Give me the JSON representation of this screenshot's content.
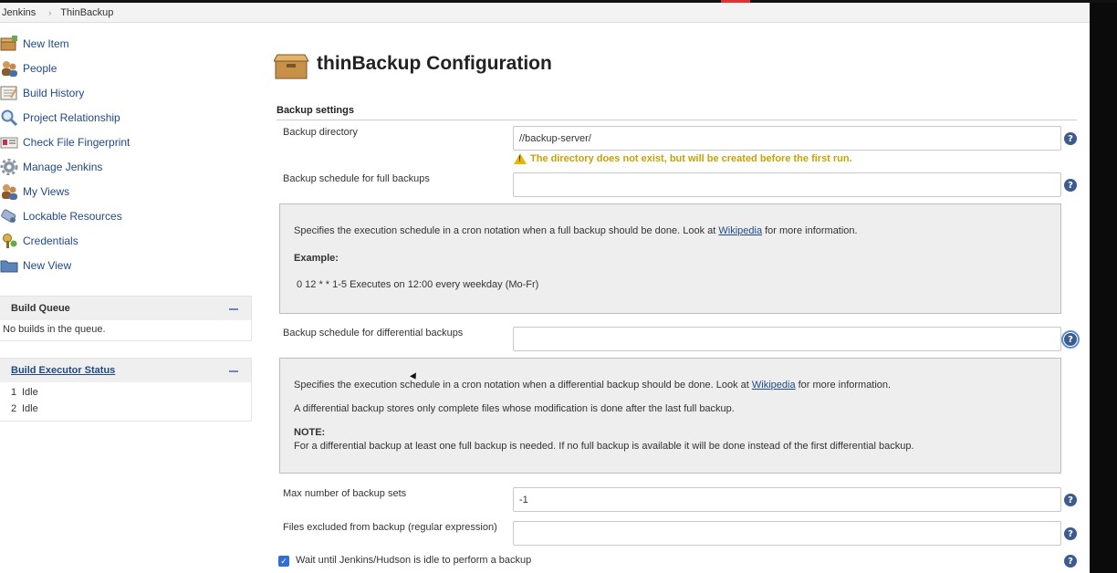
{
  "breadcrumb": {
    "root": "Jenkins",
    "separator": "›",
    "current": "ThinBackup"
  },
  "sidebar": {
    "tasks": [
      {
        "label": "New Item",
        "icon": "new-item-icon"
      },
      {
        "label": "People",
        "icon": "people-icon"
      },
      {
        "label": "Build History",
        "icon": "notepad-icon"
      },
      {
        "label": "Project Relationship",
        "icon": "search-icon"
      },
      {
        "label": "Check File Fingerprint",
        "icon": "fingerprint-icon"
      },
      {
        "label": "Manage Jenkins",
        "icon": "gear-icon"
      },
      {
        "label": "My Views",
        "icon": "user-icon"
      },
      {
        "label": "Lockable Resources",
        "icon": "lock-icon"
      },
      {
        "label": "Credentials",
        "icon": "credentials-icon"
      },
      {
        "label": "New View",
        "icon": "folder-icon"
      }
    ],
    "build_queue": {
      "title": "Build Queue",
      "empty_text": "No builds in the queue."
    },
    "executor_status": {
      "title": "Build Executor Status",
      "executors": [
        {
          "number": "1",
          "state": "Idle"
        },
        {
          "number": "2",
          "state": "Idle"
        }
      ]
    }
  },
  "main": {
    "title": "thinBackup Configuration",
    "section": "Backup settings",
    "backup_directory": {
      "label": "Backup directory",
      "value": "//backup-server/",
      "warning": "The directory does not exist, but will be created before the first run."
    },
    "full_schedule": {
      "label": "Backup schedule for full backups",
      "value": "",
      "help_text_before": "Specifies the execution schedule in a cron notation when a full backup should be done. Look at ",
      "help_link": "Wikipedia",
      "help_text_after": " for more information.",
      "example_heading": "Example:",
      "example": "0 12 * * 1-5 Executes on 12:00 every weekday (Mo-Fr)"
    },
    "diff_schedule": {
      "label": "Backup schedule for differential backups",
      "value": "",
      "help_text_before": "Specifies the execution schedule in a cron notation when a differential backup should be done. Look at ",
      "help_link": "Wikipedia",
      "help_text_after": " for more information.",
      "help_text_2": "A differential backup stores only complete files whose modification is done after the last full backup.",
      "note_heading": "NOTE:",
      "note_text": "For a differential backup at least one full backup is needed. If no full backup is available it will be done instead of the first differential backup."
    },
    "max_sets": {
      "label": "Max number of backup sets",
      "value": "-1"
    },
    "excluded": {
      "label": "Files excluded from backup (regular expression)",
      "value": ""
    },
    "wait_idle": {
      "label": "Wait until Jenkins/Hudson is idle to perform a backup",
      "checked": true
    },
    "help_glyph": "?",
    "check_glyph": "✓"
  },
  "colors": {
    "link": "#204a87",
    "warning": "#c9a100",
    "help_icon": "#3b5c8c",
    "checkbox": "#2e6ed6"
  }
}
